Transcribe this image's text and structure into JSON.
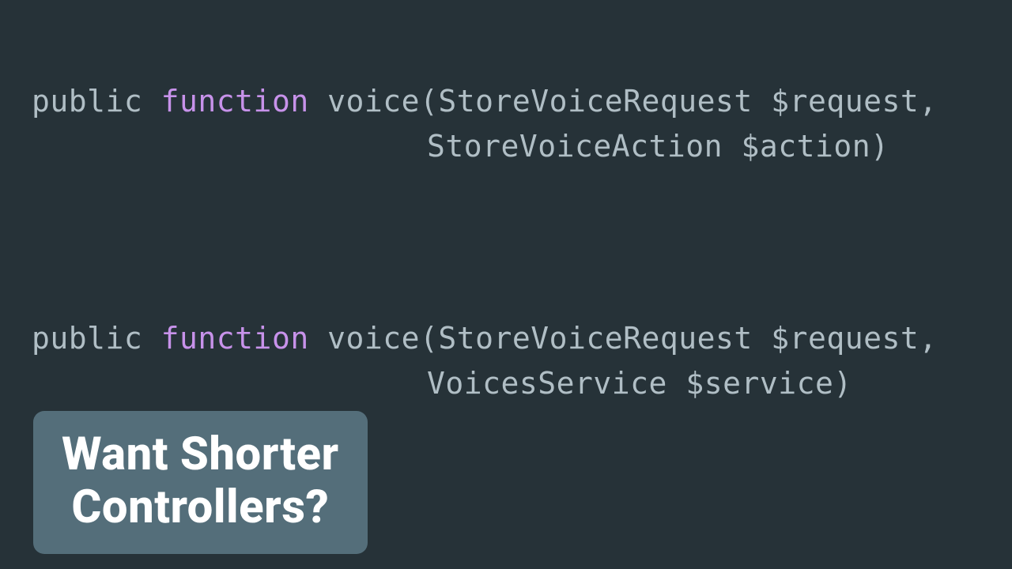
{
  "code1": {
    "public": "public",
    "function": "function",
    "fn": "voice",
    "p1_type": "StoreVoiceRequest",
    "p1_var": "$request",
    "p2_type": "StoreVoiceAction",
    "p2_var": "$action"
  },
  "code2": {
    "public": "public",
    "function": "function",
    "fn": "voice",
    "p1_type": "StoreVoiceRequest",
    "p1_var": "$request",
    "p2_type": "VoicesService",
    "p2_var": "$service"
  },
  "callout": {
    "line1": "Want Shorter",
    "line2": "Controllers?"
  }
}
